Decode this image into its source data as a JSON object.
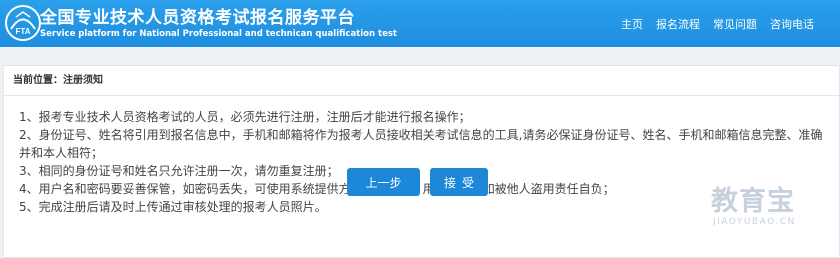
{
  "header": {
    "logo_text": "FTA",
    "title_cn": "全国专业技术人员资格考试报名服务平台",
    "title_en": "Service platform for National Professional and technican qualification test",
    "nav": [
      {
        "label": "主页"
      },
      {
        "label": "报名流程"
      },
      {
        "label": "常见问题"
      },
      {
        "label": "咨询电话"
      }
    ]
  },
  "breadcrumb": {
    "prefix": "当前位置：",
    "current": "注册须知"
  },
  "notes": [
    "1、报考专业技术人员资格考试的人员，必须先进行注册，注册后才能进行报名操作；",
    "2、身份证号、姓名将引用到报名信息中，手机和邮箱将作为报考人员接收相关考试信息的工具,请务必保证身份证号、姓名、手机和邮箱信息完整、准确并和本人相符；",
    "3、相同的身份证号和姓名只允许注册一次，请勿重复注册；",
    "4、用户名和密码要妥善保管，如密码丢失，可使用系统提供方式找回密码。用户和密码如被他人盗用责任自负；",
    "5、完成注册后请及时上传通过审核处理的报考人员照片。"
  ],
  "buttons": {
    "prev_label": "上一步",
    "accept_label": "接受"
  },
  "watermark": {
    "cn": "教育宝",
    "en": "JIAOYUBAO.CN"
  },
  "colors": {
    "header_blue": "#2196e8",
    "button_blue": "#1d88d8"
  }
}
